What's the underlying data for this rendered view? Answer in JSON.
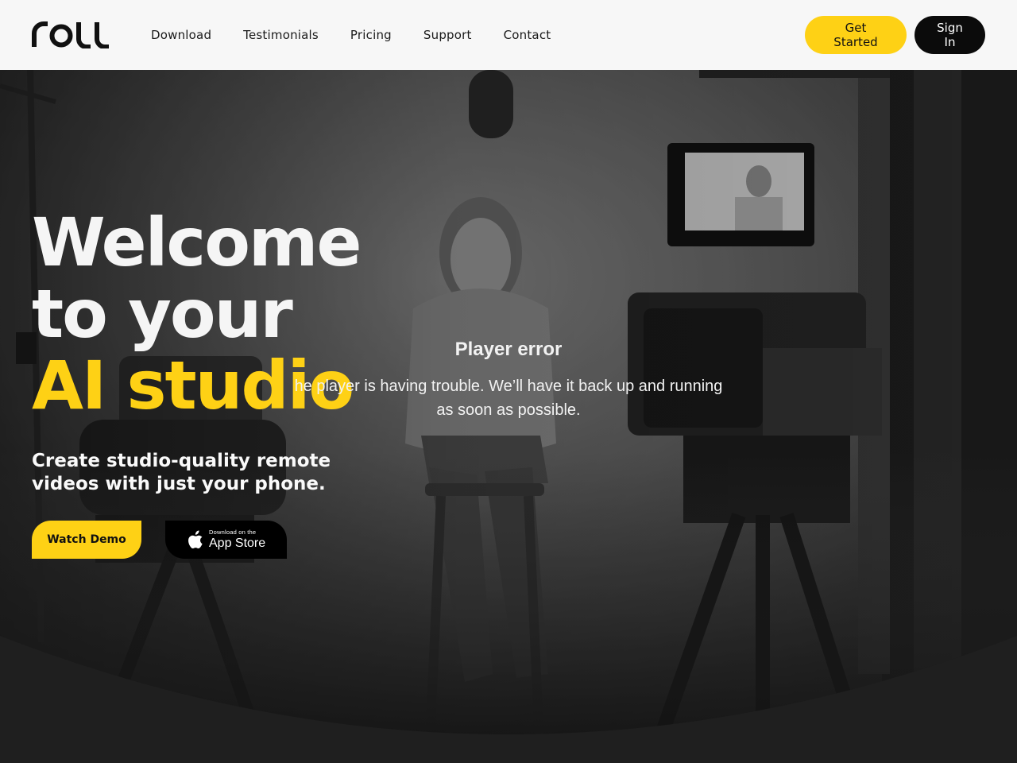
{
  "brand": {
    "logo_text": "roll"
  },
  "nav": {
    "items": [
      {
        "label": "Download"
      },
      {
        "label": "Testimonials"
      },
      {
        "label": "Pricing"
      },
      {
        "label": "Support"
      },
      {
        "label": "Contact"
      }
    ]
  },
  "header_actions": {
    "get_started": "Get Started",
    "sign_in": "Sign In"
  },
  "hero": {
    "headline_line1": "Welcome",
    "headline_line2": "to your",
    "headline_line3": "AI studio",
    "subheadline": "Create studio-quality remote videos with just your phone.",
    "watch_demo": "Watch Demo",
    "app_store_small": "Download on the",
    "app_store_big": "App Store"
  },
  "player_error": {
    "title": "Player error",
    "message": "he player is having trouble. We’ll have it back up and running as soon as possible."
  },
  "colors": {
    "accent_yellow": "#fed115",
    "header_bg": "#f7f7f7",
    "dark": "#0b0b0b"
  },
  "icons": [
    "apple-icon"
  ]
}
